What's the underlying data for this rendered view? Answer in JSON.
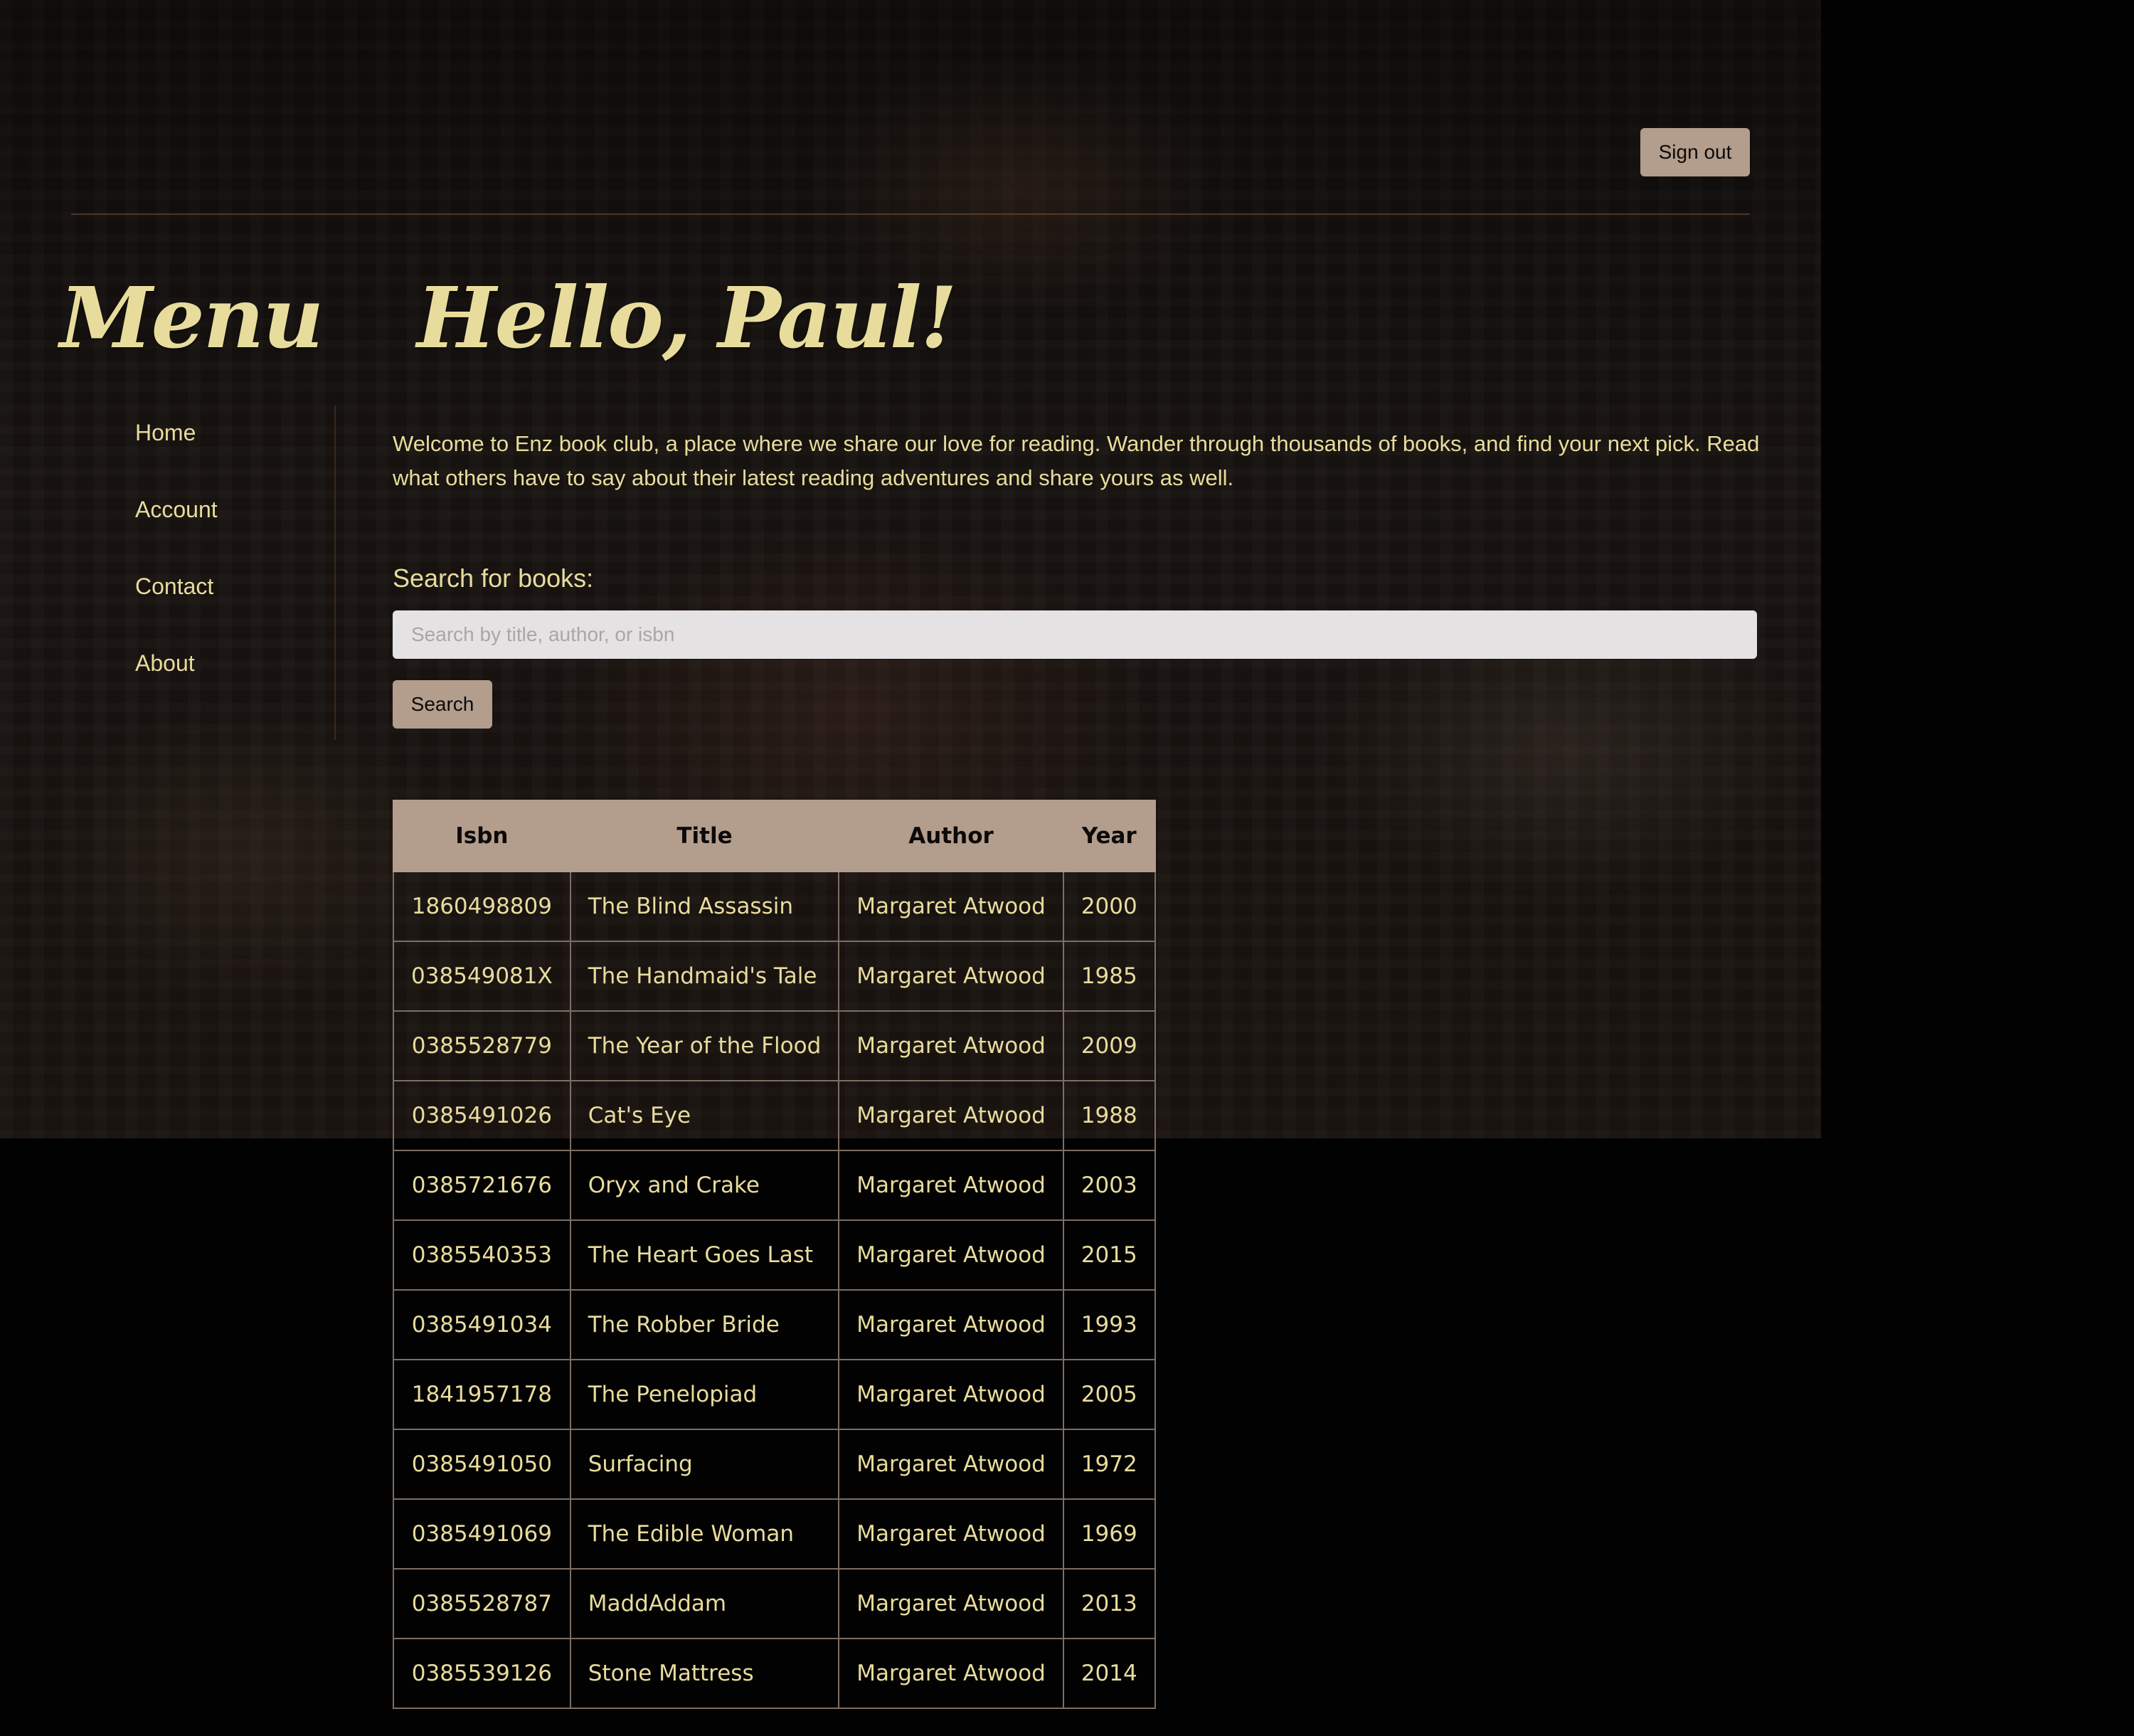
{
  "header": {
    "sign_out_label": "Sign out"
  },
  "sidebar": {
    "heading": "Menu",
    "items": [
      {
        "label": "Home"
      },
      {
        "label": "Account"
      },
      {
        "label": "Contact"
      },
      {
        "label": "About"
      }
    ]
  },
  "main": {
    "greeting": "Hello, Paul!",
    "welcome_text": "Welcome to Enz book club, a place where we share our love for reading. Wander through thousands of books, and find your next pick. Read what others have to say about their latest reading adventures and share yours as well.",
    "search": {
      "label": "Search for books:",
      "placeholder": "Search by title, author, or isbn",
      "value": "",
      "button_label": "Search"
    },
    "table": {
      "columns": [
        "Isbn",
        "Title",
        "Author",
        "Year"
      ],
      "rows": [
        [
          "1860498809",
          "The Blind Assassin",
          "Margaret Atwood",
          "2000"
        ],
        [
          "038549081X",
          "The Handmaid's Tale",
          "Margaret Atwood",
          "1985"
        ],
        [
          "0385528779",
          "The Year of the Flood",
          "Margaret Atwood",
          "2009"
        ],
        [
          "0385491026",
          "Cat's Eye",
          "Margaret Atwood",
          "1988"
        ],
        [
          "0385721676",
          "Oryx and Crake",
          "Margaret Atwood",
          "2003"
        ],
        [
          "0385540353",
          "The Heart Goes Last",
          "Margaret Atwood",
          "2015"
        ],
        [
          "0385491034",
          "The Robber Bride",
          "Margaret Atwood",
          "1993"
        ],
        [
          "1841957178",
          "The Penelopiad",
          "Margaret Atwood",
          "2005"
        ],
        [
          "0385491050",
          "Surfacing",
          "Margaret Atwood",
          "1972"
        ],
        [
          "0385491069",
          "The Edible Woman",
          "Margaret Atwood",
          "1969"
        ],
        [
          "0385528787",
          "MaddAddam",
          "Margaret Atwood",
          "2013"
        ],
        [
          "0385539126",
          "Stone Mattress",
          "Margaret Atwood",
          "2014"
        ]
      ]
    }
  },
  "colors": {
    "accent_text": "#e8dc9c",
    "button_bg": "#b39d8c",
    "page_bg": "#030202"
  }
}
